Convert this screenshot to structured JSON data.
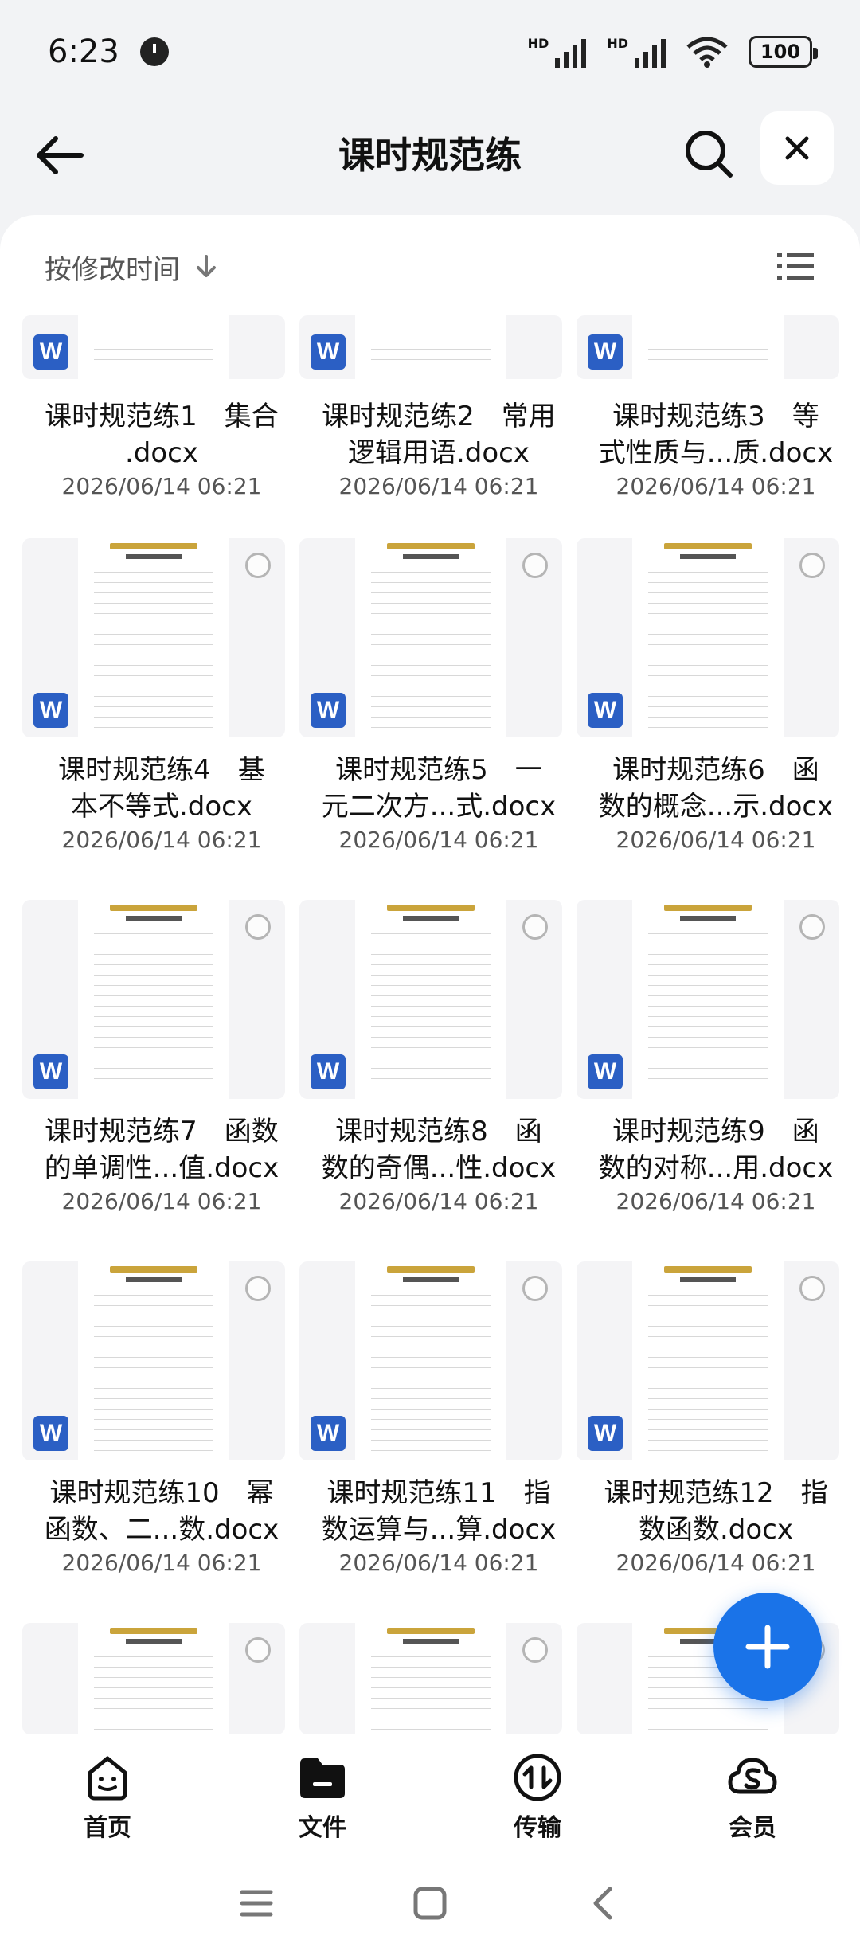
{
  "status": {
    "time": "6:23",
    "battery": "100",
    "network_label": "HD"
  },
  "appbar": {
    "title": "课时规范练"
  },
  "sort": {
    "label": "按修改时间"
  },
  "files": [
    {
      "name": "课时规范练1　集合\n.docx",
      "date": "2026/06/14 06:21"
    },
    {
      "name": "课时规范练2　常用\n逻辑用语.docx",
      "date": "2026/06/14 06:21"
    },
    {
      "name": "课时规范练3　等\n式性质与...质.docx",
      "date": "2026/06/14 06:21"
    },
    {
      "name": "课时规范练4　基\n本不等式.docx",
      "date": "2026/06/14 06:21"
    },
    {
      "name": "课时规范练5　一\n元二次方...式.docx",
      "date": "2026/06/14 06:21"
    },
    {
      "name": "课时规范练6　函\n数的概念...示.docx",
      "date": "2026/06/14 06:21"
    },
    {
      "name": "课时规范练7　函数\n的单调性...值.docx",
      "date": "2026/06/14 06:21"
    },
    {
      "name": "课时规范练8　函\n数的奇偶...性.docx",
      "date": "2026/06/14 06:21"
    },
    {
      "name": "课时规范练9　函\n数的对称...用.docx",
      "date": "2026/06/14 06:21"
    },
    {
      "name": "课时规范练10　幂\n函数、二...数.docx",
      "date": "2026/06/14 06:21"
    },
    {
      "name": "课时规范练11　指\n数运算与...算.docx",
      "date": "2026/06/14 06:21"
    },
    {
      "name": "课时规范练12　指\n数函数.docx",
      "date": "2026/06/14 06:21"
    }
  ],
  "word_badge": "W",
  "nav": [
    {
      "label": "首页",
      "icon": "home-face-icon"
    },
    {
      "label": "文件",
      "icon": "folder-icon"
    },
    {
      "label": "传输",
      "icon": "transfer-icon"
    },
    {
      "label": "会员",
      "icon": "vip-cloud-icon"
    }
  ]
}
